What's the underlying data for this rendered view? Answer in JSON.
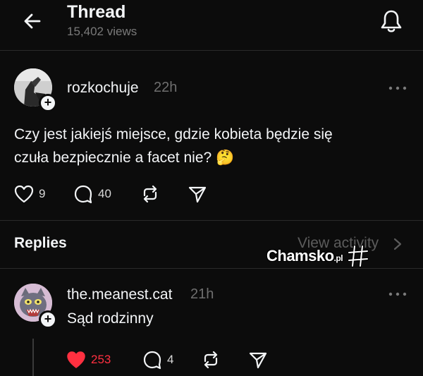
{
  "header": {
    "title": "Thread",
    "views": "15,402 views"
  },
  "post": {
    "username": "rozkochuje",
    "time": "22h",
    "text": "Czy jest jakiejś miejsce, gdzie kobieta będzie się czuła bezpiecznie a facet nie? 🤔",
    "likes": "9",
    "comments": "40"
  },
  "replies_section": {
    "label": "Replies",
    "view_activity": "View activity"
  },
  "watermark": {
    "brand": "Chamsko",
    "suffix": ".pl"
  },
  "reply": {
    "username": "the.meanest.cat",
    "time": "21h",
    "text": "Sąd rodzinny",
    "likes": "253",
    "comments": "4",
    "liked": true
  },
  "colors": {
    "background": "#0c0c0c",
    "text": "#f3f5f7",
    "muted": "#6f6f6f",
    "like_red": "#ff3040"
  }
}
